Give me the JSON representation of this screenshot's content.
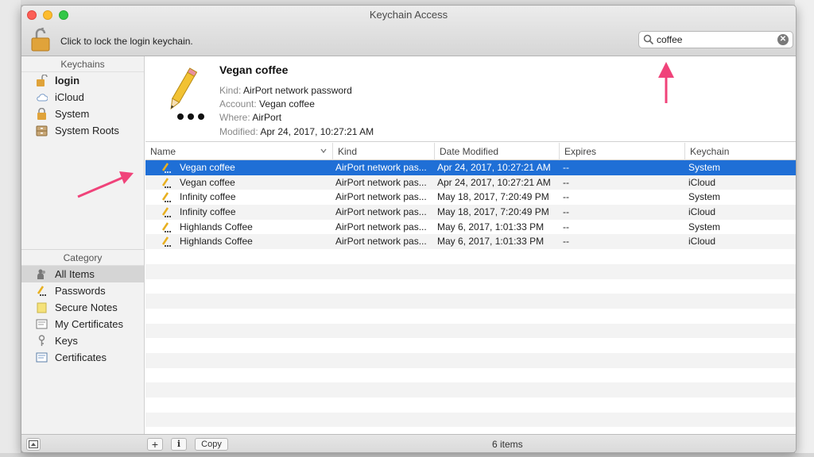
{
  "window": {
    "title": "Keychain Access",
    "lock_label": "Click to lock the login keychain."
  },
  "search": {
    "value": "coffee",
    "placeholder": "Search"
  },
  "sidebar": {
    "keychains_header": "Keychains",
    "keychains": [
      {
        "label": "login",
        "icon": "lock-open-icon"
      },
      {
        "label": "iCloud",
        "icon": "cloud-icon"
      },
      {
        "label": "System",
        "icon": "lock-closed-icon"
      },
      {
        "label": "System Roots",
        "icon": "cabinet-icon"
      }
    ],
    "category_header": "Category",
    "categories": [
      {
        "label": "All Items",
        "icon": "people-icon"
      },
      {
        "label": "Passwords",
        "icon": "pencil-dots-icon"
      },
      {
        "label": "Secure Notes",
        "icon": "note-icon"
      },
      {
        "label": "My Certificates",
        "icon": "certificate-icon"
      },
      {
        "label": "Keys",
        "icon": "key-icon"
      },
      {
        "label": "Certificates",
        "icon": "certificate-icon"
      }
    ]
  },
  "detail": {
    "title": "Vegan coffee",
    "kind_key": "Kind:",
    "kind": "AirPort network password",
    "account_key": "Account:",
    "account": "Vegan coffee",
    "where_key": "Where:",
    "where": "AirPort",
    "modified_key": "Modified:",
    "modified": "Apr 24, 2017, 10:27:21 AM"
  },
  "table": {
    "columns": [
      "Name",
      "Kind",
      "Date Modified",
      "Expires",
      "Keychain"
    ],
    "rows": [
      [
        "Vegan coffee",
        "AirPort network pas...",
        "Apr 24, 2017, 10:27:21 AM",
        "--",
        "System"
      ],
      [
        "Vegan coffee",
        "AirPort network pas...",
        "Apr 24, 2017, 10:27:21 AM",
        "--",
        "iCloud"
      ],
      [
        "Infinity coffee",
        "AirPort network pas...",
        "May 18, 2017, 7:20:49 PM",
        "--",
        "System"
      ],
      [
        "Infinity coffee",
        "AirPort network pas...",
        "May 18, 2017, 7:20:49 PM",
        "--",
        "iCloud"
      ],
      [
        "Highlands Coffee",
        "AirPort network pas...",
        "May 6, 2017, 1:01:33 PM",
        "--",
        "System"
      ],
      [
        "Highlands Coffee",
        "AirPort network pas...",
        "May 6, 2017, 1:01:33 PM",
        "--",
        "iCloud"
      ]
    ],
    "selected_row": 0
  },
  "statusbar": {
    "add_label": "+",
    "info_label": "i",
    "copy_label": "Copy",
    "count": "6 items"
  },
  "colors": {
    "selection": "#1f6fd6",
    "annotation_arrow": "#f0437a"
  }
}
